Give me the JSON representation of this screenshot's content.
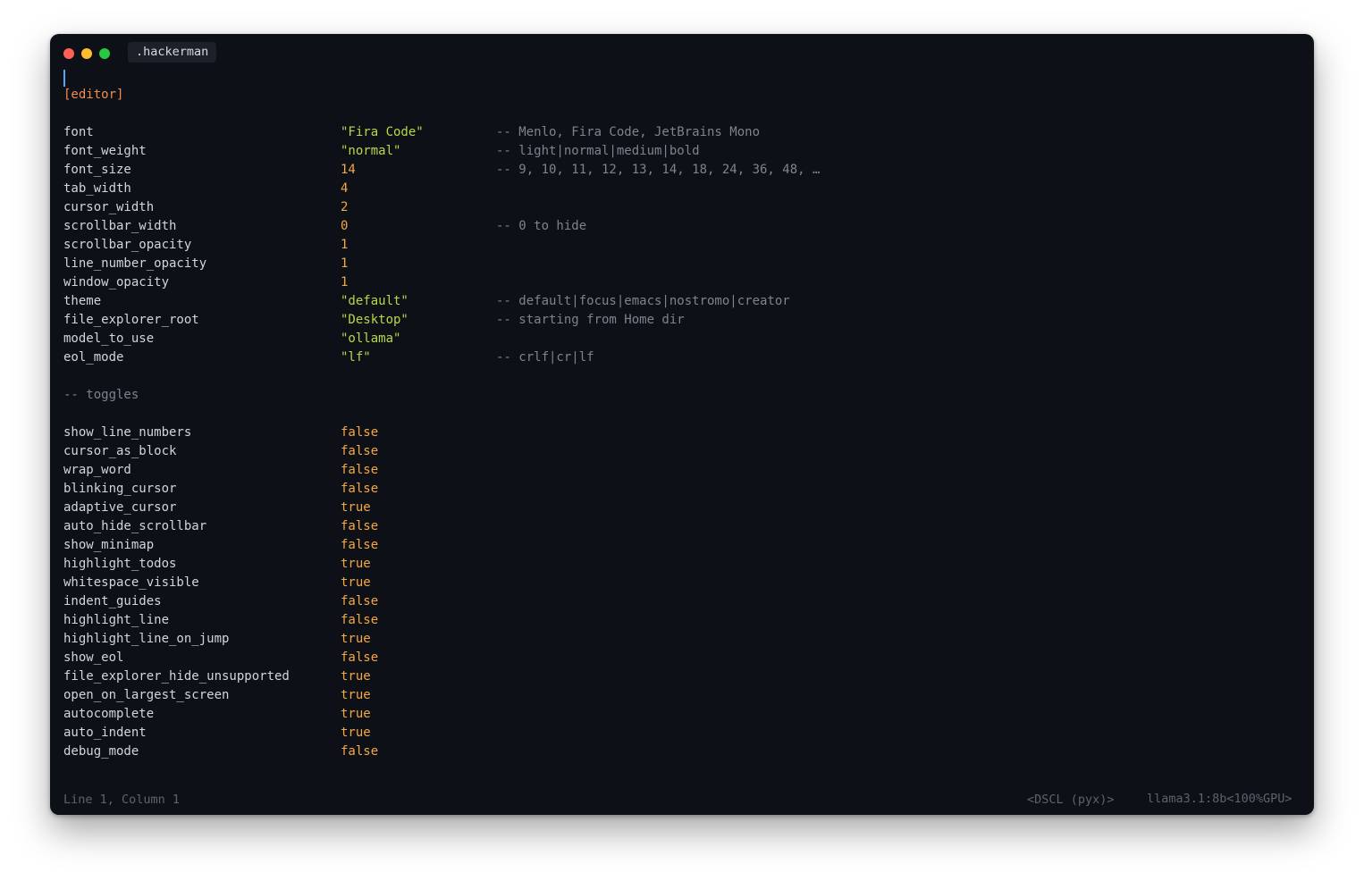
{
  "window": {
    "tab_title": ".hackerman"
  },
  "editor": {
    "section_header": "[editor]",
    "settings": [
      {
        "key": "font",
        "value": "\"Fira Code\"",
        "type": "str",
        "comment": "-- Menlo, Fira Code, JetBrains Mono"
      },
      {
        "key": "font_weight",
        "value": "\"normal\"",
        "type": "str",
        "comment": "-- light|normal|medium|bold"
      },
      {
        "key": "font_size",
        "value": "14",
        "type": "num",
        "comment": "-- 9, 10, 11, 12, 13, 14, 18, 24, 36, 48, …"
      },
      {
        "key": "tab_width",
        "value": "4",
        "type": "num",
        "comment": ""
      },
      {
        "key": "cursor_width",
        "value": "2",
        "type": "num",
        "comment": ""
      },
      {
        "key": "scrollbar_width",
        "value": "0",
        "type": "num",
        "comment": "-- 0 to hide"
      },
      {
        "key": "scrollbar_opacity",
        "value": "1",
        "type": "num",
        "comment": ""
      },
      {
        "key": "line_number_opacity",
        "value": "1",
        "type": "num",
        "comment": ""
      },
      {
        "key": "window_opacity",
        "value": "1",
        "type": "num",
        "comment": ""
      },
      {
        "key": "theme",
        "value": "\"default\"",
        "type": "str",
        "comment": "-- default|focus|emacs|nostromo|creator"
      },
      {
        "key": "file_explorer_root",
        "value": "\"Desktop\"",
        "type": "str",
        "comment": "-- starting from Home dir"
      },
      {
        "key": "model_to_use",
        "value": "\"ollama\"",
        "type": "str",
        "comment": ""
      },
      {
        "key": "eol_mode",
        "value": "\"lf\"",
        "type": "str",
        "comment": "-- crlf|cr|lf"
      }
    ],
    "toggles_comment": "-- toggles",
    "toggles": [
      {
        "key": "show_line_numbers",
        "value": "false"
      },
      {
        "key": "cursor_as_block",
        "value": "false"
      },
      {
        "key": "wrap_word",
        "value": "false"
      },
      {
        "key": "blinking_cursor",
        "value": "false"
      },
      {
        "key": "adaptive_cursor",
        "value": "true"
      },
      {
        "key": "auto_hide_scrollbar",
        "value": "false"
      },
      {
        "key": "show_minimap",
        "value": "false"
      },
      {
        "key": "highlight_todos",
        "value": "true"
      },
      {
        "key": "whitespace_visible",
        "value": "true"
      },
      {
        "key": "indent_guides",
        "value": "false"
      },
      {
        "key": "highlight_line",
        "value": "false"
      },
      {
        "key": "highlight_line_on_jump",
        "value": "true"
      },
      {
        "key": "show_eol",
        "value": "false"
      },
      {
        "key": "file_explorer_hide_unsupported",
        "value": "true"
      },
      {
        "key": "open_on_largest_screen",
        "value": "true"
      },
      {
        "key": "autocomplete",
        "value": "true"
      },
      {
        "key": "auto_indent",
        "value": "true"
      },
      {
        "key": "debug_mode",
        "value": "false"
      }
    ]
  },
  "statusbar": {
    "position": "Line 1, Column 1",
    "mode": "<DSCL (pyx)>",
    "model": "llama3.1:8b<100%GPU>"
  },
  "colors": {
    "background": "#0d1117",
    "section": "#f08d49",
    "string": "#b5d94a",
    "number": "#f5a742",
    "comment": "#7d848e",
    "caret": "#5aa2f5"
  }
}
